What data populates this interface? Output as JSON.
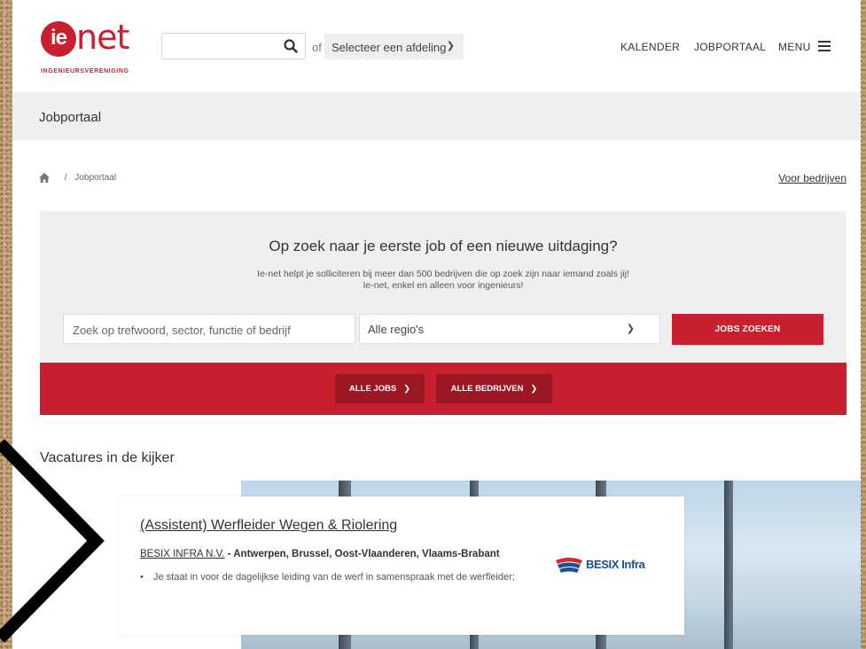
{
  "logo": {
    "mark": "ie",
    "name": "net",
    "subtitle": "INGENIEURSVERENIGING"
  },
  "header": {
    "search_placeholder": "",
    "of_label": "of",
    "department_select": "Selecteer een afdeling",
    "nav": {
      "kalender": "KALENDER",
      "jobportaal": "JOBPORTAAL",
      "menu": "MENU"
    }
  },
  "title_bar": {
    "title": "Jobportaal"
  },
  "breadcrumb": {
    "separator": "/",
    "current": "Jobportaal",
    "right_link": "Voor bedrijven"
  },
  "search_panel": {
    "heading": "Op zoek naar je eerste job of een nieuwe uitdaging?",
    "sub_line1": "Ie-net helpt je solliciteren bij meer dan 500 bedrijven die op zoek zijn naar iemand zoals jij!",
    "sub_line2": "Ie-net, enkel en alleen voor ingenieurs!",
    "keyword_placeholder": "Zoek op trefwoord, sector, functie of bedrijf",
    "region_select": "Alle regio's",
    "search_button": "JOBS ZOEKEN"
  },
  "band": {
    "all_jobs": "ALLE JOBS",
    "all_companies": "ALLE BEDRIJVEN"
  },
  "featured": {
    "heading": "Vacatures in de kijker",
    "vacancy": {
      "title": "(Assistent) Werfleider Wegen & Riolering",
      "company": "BESIX INFRA N.V.",
      "location": " - Antwerpen, Brussel, Oost-Vlaanderen, Vlaams-Brabant",
      "bullet": "Je staat in voor de dagelijkse leiding van de werf in samenspraak met de werfleider;",
      "logo_text": "BESIX Infra"
    }
  },
  "colors": {
    "brand_red": "#c8202f",
    "dark_red": "#9c1624",
    "panel_grey": "#efefef",
    "besix_blue": "#1d4f91"
  },
  "icons": [
    "search-icon",
    "chevron-down-icon",
    "hamburger-icon",
    "home-icon",
    "chevron-right-icon"
  ]
}
